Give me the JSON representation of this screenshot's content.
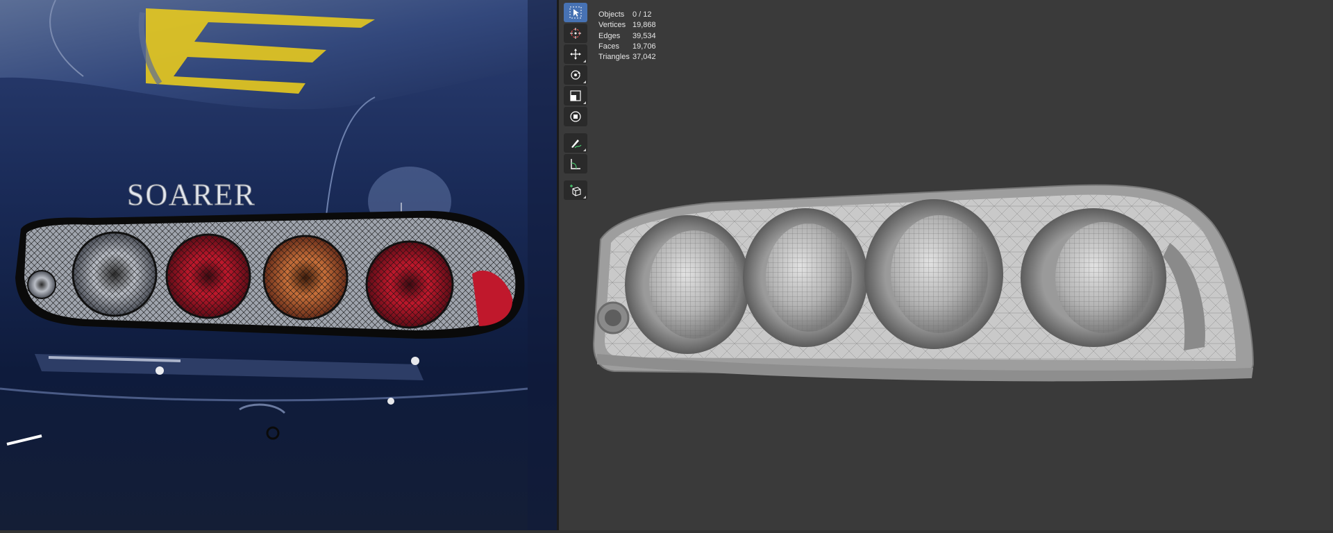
{
  "reference": {
    "badge_text": "SOARER"
  },
  "toolbar": {
    "tools": [
      {
        "name": "select-box",
        "icon": "cursor-select-icon",
        "active": true
      },
      {
        "name": "cursor",
        "icon": "3d-cursor-icon",
        "active": false
      },
      {
        "name": "move",
        "icon": "move-arrows-icon",
        "active": false
      },
      {
        "name": "rotate",
        "icon": "rotate-icon",
        "active": false
      },
      {
        "name": "scale",
        "icon": "scale-icon",
        "active": false
      },
      {
        "name": "transform",
        "icon": "transform-icon",
        "active": false
      },
      {
        "name": "annotate",
        "icon": "annotate-pencil-icon",
        "active": false
      },
      {
        "name": "measure",
        "icon": "measure-ruler-icon",
        "active": false
      },
      {
        "name": "add-cube",
        "icon": "add-cube-icon",
        "active": false
      }
    ],
    "active_color": "#4772b3"
  },
  "stats": {
    "rows": [
      {
        "label": "Objects",
        "value": "0 / 12"
      },
      {
        "label": "Vertices",
        "value": "19,868"
      },
      {
        "label": "Edges",
        "value": "39,534"
      },
      {
        "label": "Faces",
        "value": "19,706"
      },
      {
        "label": "Triangles",
        "value": "37,042"
      }
    ]
  }
}
